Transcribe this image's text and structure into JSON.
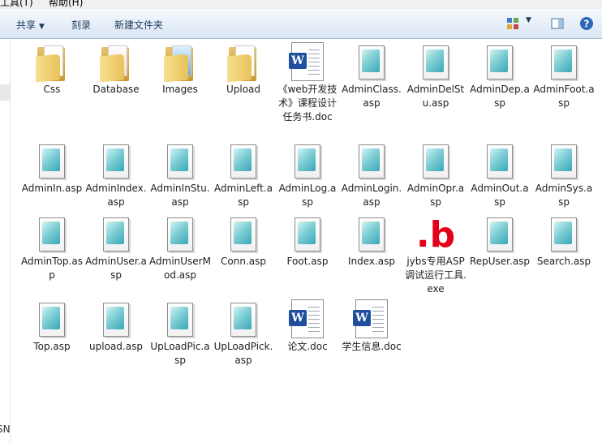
{
  "menu": {
    "tools": "工具(T)",
    "help": "帮助(H)"
  },
  "toolbar": {
    "share": "共享",
    "burn": "刻录",
    "new_folder": "新建文件夹"
  },
  "left_fragment": "SN",
  "files": [
    {
      "name": "Css",
      "type": "folder"
    },
    {
      "name": "Database",
      "type": "folder"
    },
    {
      "name": "Images",
      "type": "folder"
    },
    {
      "name": "Upload",
      "type": "folder"
    },
    {
      "name": "《web开发技术》课程设计任务书.doc",
      "type": "doc"
    },
    {
      "name": "AdminClass.asp",
      "type": "asp"
    },
    {
      "name": "AdminDelStu.asp",
      "type": "asp"
    },
    {
      "name": "AdminDep.asp",
      "type": "asp"
    },
    {
      "name": "AdminFoot.asp",
      "type": "asp"
    },
    {
      "name": "AdminIn.asp",
      "type": "asp"
    },
    {
      "name": "AdminIndex.asp",
      "type": "asp"
    },
    {
      "name": "AdminInStu.asp",
      "type": "asp"
    },
    {
      "name": "AdminLeft.asp",
      "type": "asp"
    },
    {
      "name": "AdminLog.asp",
      "type": "asp"
    },
    {
      "name": "AdminLogin.asp",
      "type": "asp"
    },
    {
      "name": "AdminOpr.asp",
      "type": "asp"
    },
    {
      "name": "AdminOut.asp",
      "type": "asp"
    },
    {
      "name": "AdminSys.asp",
      "type": "asp"
    },
    {
      "name": "AdminTop.asp",
      "type": "asp"
    },
    {
      "name": "AdminUser.asp",
      "type": "asp"
    },
    {
      "name": "AdminUserMod.asp",
      "type": "asp"
    },
    {
      "name": "Conn.asp",
      "type": "asp"
    },
    {
      "name": "Foot.asp",
      "type": "asp"
    },
    {
      "name": "Index.asp",
      "type": "asp"
    },
    {
      "name": "jybs专用ASP调试运行工具.exe",
      "type": "exe",
      "icon_glyph": ".b"
    },
    {
      "name": "RepUser.asp",
      "type": "asp"
    },
    {
      "name": "Search.asp",
      "type": "asp"
    },
    {
      "name": "Top.asp",
      "type": "asp"
    },
    {
      "name": "upload.asp",
      "type": "asp"
    },
    {
      "name": "UpLoadPic.asp",
      "type": "asp"
    },
    {
      "name": "UpLoadPick.asp",
      "type": "asp"
    },
    {
      "name": "论文.doc",
      "type": "doc"
    },
    {
      "name": "学生信息.doc",
      "type": "doc"
    }
  ]
}
